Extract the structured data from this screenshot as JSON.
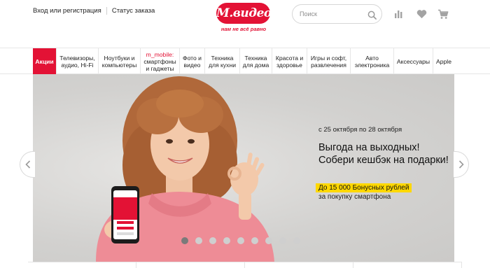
{
  "header": {
    "login_label": "Вход или регистрация",
    "order_status_label": "Статус заказа",
    "logo_text": "М.видео",
    "logo_tagline": "нам не всё равно",
    "search_placeholder": "Поиск",
    "icons": [
      "search-icon",
      "compare-icon",
      "heart-icon",
      "cart-icon"
    ]
  },
  "nav": {
    "items": [
      {
        "label": "Акции",
        "active": true
      },
      {
        "label": "Телевизоры, аудио, Hi-Fi"
      },
      {
        "label": "Ноутбуки и компьютеры"
      },
      {
        "label_accent": "m_mobile:",
        "label": "смартфоны и гаджеты"
      },
      {
        "label": "Фото и видео"
      },
      {
        "label": "Техника для кухни"
      },
      {
        "label": "Техника для дома"
      },
      {
        "label": "Красота и здоровье"
      },
      {
        "label": "Игры и софт, развлечения"
      },
      {
        "label": "Авто электроника"
      },
      {
        "label": "Аксессуары"
      },
      {
        "label": "Apple"
      }
    ]
  },
  "banner": {
    "date_text": "с 25 октября по 28 октября",
    "title": "Выгода на выходных! Собери кешбэк на подарки!",
    "badge_text": "До 15 000 Бонусных рублей",
    "subtitle": "за покупку смартфона",
    "slides_count": 9,
    "active_slide": 1
  },
  "colors": {
    "brand": "#e31235",
    "badge": "#ffd800",
    "banner_bg": "#d7d6d4"
  }
}
